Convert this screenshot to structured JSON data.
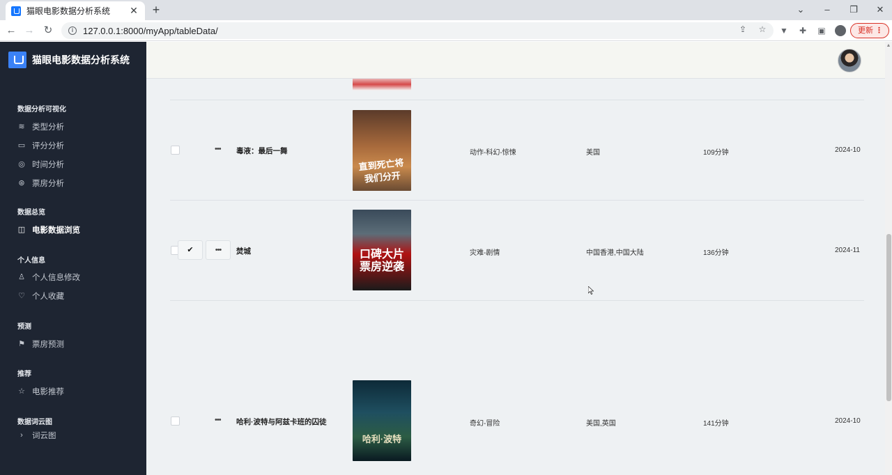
{
  "browser": {
    "tab_title": "猫眼电影数据分析系统",
    "url": "127.0.0.1:8000/myApp/tableData/",
    "update_label": "更新"
  },
  "sidebar": {
    "brand": "猫眼电影数据分析系统",
    "sections": [
      {
        "header": "数据分析可视化",
        "items": [
          {
            "label": "类型分析",
            "icon": "layers-icon"
          },
          {
            "label": "评分分析",
            "icon": "cast-icon"
          },
          {
            "label": "时间分析",
            "icon": "watch-icon"
          },
          {
            "label": "票房分析",
            "icon": "life-buoy-icon"
          }
        ]
      },
      {
        "header": "数据总览",
        "items": [
          {
            "label": "电影数据浏览",
            "icon": "columns-icon",
            "active": true
          }
        ]
      },
      {
        "header": "个人信息",
        "items": [
          {
            "label": "个人信息修改",
            "icon": "user-icon"
          },
          {
            "label": "个人收藏",
            "icon": "heart-icon"
          }
        ]
      },
      {
        "header": "预测",
        "items": [
          {
            "label": "票房预测",
            "icon": "flag-icon"
          }
        ]
      },
      {
        "header": "推荐",
        "items": [
          {
            "label": "电影推荐",
            "icon": "star-icon"
          }
        ]
      },
      {
        "header": "数据词云图",
        "items": [
          {
            "label": "词云图",
            "icon": "chevron-icon"
          }
        ]
      }
    ]
  },
  "table": {
    "rows": [
      {
        "title": "毒液：最后一舞",
        "genre": "动作-科幻-惊悚",
        "region": "美国",
        "duration": "109分钟",
        "date": "2024-10",
        "poster_text": "直到死亡将我们分开"
      },
      {
        "title": "焚城",
        "genre": "灾难-剧情",
        "region": "中国香港,中国大陆",
        "duration": "136分钟",
        "date": "2024-11",
        "poster_text": "口碑大片票房逆袭"
      },
      {
        "title": "哈利·波特与阿兹卡班的囚徒",
        "genre": "奇幻-冒险",
        "region": "美国,英国",
        "duration": "141分钟",
        "date": "2024-10",
        "poster_text": "哈利·波特"
      }
    ]
  }
}
